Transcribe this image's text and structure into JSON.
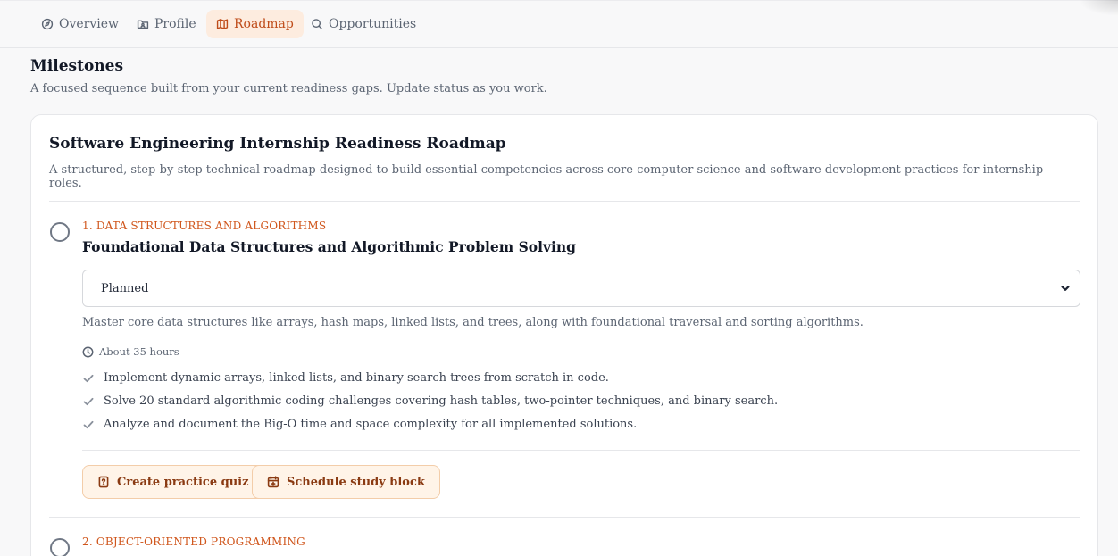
{
  "nav": {
    "tabs": [
      {
        "label": "Overview",
        "icon": "compass-icon"
      },
      {
        "label": "Profile",
        "icon": "folder-user-icon"
      },
      {
        "label": "Roadmap",
        "icon": "map-icon",
        "active": true
      },
      {
        "label": "Opportunities",
        "icon": "search-icon"
      }
    ]
  },
  "page": {
    "title": "Milestones",
    "subtitle": "A focused sequence built from your current readiness gaps. Update status as you work."
  },
  "roadmap": {
    "title": "Software Engineering Internship Readiness Roadmap",
    "description": "A structured, step-by-step technical roadmap designed to build essential competencies across core computer science and software development practices for internship roles.",
    "milestones": [
      {
        "category": "1. DATA STRUCTURES AND ALGORITHMS",
        "title": "Foundational Data Structures and Algorithmic Problem Solving",
        "status": "Planned",
        "description": "Master core data structures like arrays, hash maps, linked lists, and trees, along with foundational traversal and sorting algorithms.",
        "hours": "About 35 hours",
        "tasks": [
          "Implement dynamic arrays, linked lists, and binary search trees from scratch in code.",
          "Solve 20 standard algorithmic coding challenges covering hash tables, two-pointer techniques, and binary search.",
          "Analyze and document the Big-O time and space complexity for all implemented solutions."
        ],
        "actions": {
          "quiz_label": "Create practice quiz",
          "schedule_label": "Schedule study block"
        }
      },
      {
        "category": "2. OBJECT-ORIENTED PROGRAMMING"
      }
    ]
  },
  "colors": {
    "accent": "#d0561c",
    "accent_bg": "#fdecdf",
    "button_bg": "#fff4e8",
    "button_border": "#f3cda9",
    "button_text": "#8a3a12"
  }
}
